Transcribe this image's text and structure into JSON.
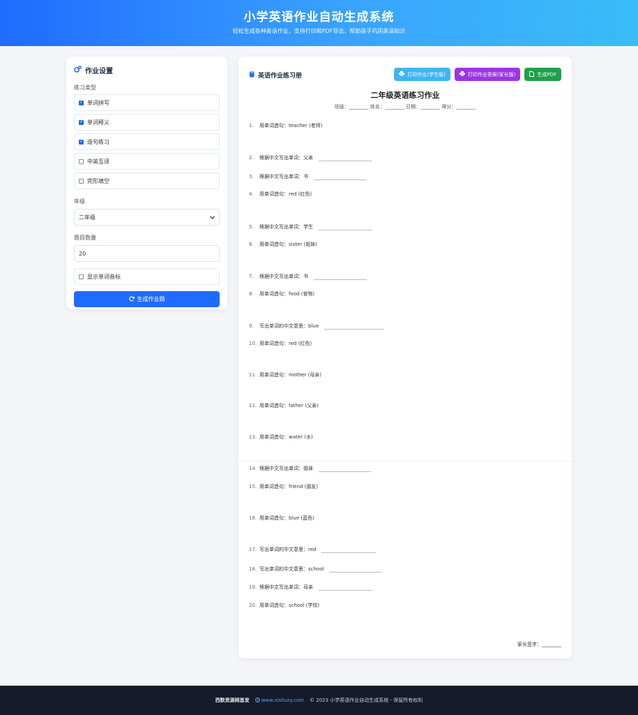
{
  "header": {
    "title": "小学英语作业自动生成系统",
    "subtitle": "轻松生成各种英语作业，支持打印和PDF导出，帮助孩子巩固英语知识"
  },
  "settings": {
    "title": "作业设置",
    "type_label": "练习类型",
    "types": [
      {
        "label": "单词拼写",
        "checked": true
      },
      {
        "label": "单词释义",
        "checked": true
      },
      {
        "label": "造句练习",
        "checked": true
      },
      {
        "label": "中英互译",
        "checked": false
      },
      {
        "label": "完形填空",
        "checked": false
      }
    ],
    "grade_label": "年级",
    "grade_value": "二年级",
    "count_label": "题目数量",
    "count_value": "20",
    "phonetic_label": "显示单词音标",
    "phonetic_checked": false,
    "generate_label": "生成作业题"
  },
  "workbook": {
    "title": "英语作业练习册",
    "btn_print_student": "打印作业(学生版)",
    "btn_print_answer": "打印作业答案(家长版)",
    "btn_pdf": "生成PDF",
    "doc_title": "二年级英语练习作业",
    "info_line": "班级：________ 姓名：________ 日期：________ 得分：________",
    "questions": [
      {
        "num": "1.",
        "text": "用单词造句：teacher (老师)"
      },
      {
        "num": "2.",
        "text": "根据中文写出单词：父亲"
      },
      {
        "num": "3.",
        "text": "根据中文写出单词：书"
      },
      {
        "num": "4.",
        "text": "用单词造句：red (红色)"
      },
      {
        "num": "5.",
        "text": "根据中文写出单词：学生"
      },
      {
        "num": "6.",
        "text": "用单词造句：sister (姐妹)"
      },
      {
        "num": "7.",
        "text": "根据中文写出单词：书"
      },
      {
        "num": "8.",
        "text": "用单词造句：food (食物)"
      },
      {
        "num": "9.",
        "text": "写出单词的中文意思：blue"
      },
      {
        "num": "10.",
        "text": "用单词造句：red (红色)"
      },
      {
        "num": "11.",
        "text": "用单词造句：mother (母亲)"
      },
      {
        "num": "12.",
        "text": "用单词造句：father (父亲)"
      },
      {
        "num": "13.",
        "text": "用单词造句：water (水)"
      },
      {
        "num": "14.",
        "text": "根据中文写出单词：姐妹"
      },
      {
        "num": "15.",
        "text": "用单词造句：friend (朋友)"
      },
      {
        "num": "16.",
        "text": "用单词造句：blue (蓝色)"
      },
      {
        "num": "17.",
        "text": "写出单词的中文意思：red"
      },
      {
        "num": "18.",
        "text": "写出单词的中文意思：school"
      },
      {
        "num": "19.",
        "text": "根据中文写出单词：母亲"
      },
      {
        "num": "20.",
        "text": "用单词造句：school (学校)"
      }
    ],
    "sign_label": "家长签字：________"
  },
  "footer": {
    "site": "西数资源网首发",
    "url": "www.xishuzy.com",
    "copyright": "© 2023 小学英语作业自动生成系统 - 保留所有权利"
  },
  "colors": {
    "primary": "#1f6bff",
    "print_student": "#3fb6f0",
    "print_answer": "#9b35e4",
    "pdf": "#20a04b",
    "footer_bg": "#161b2b"
  }
}
